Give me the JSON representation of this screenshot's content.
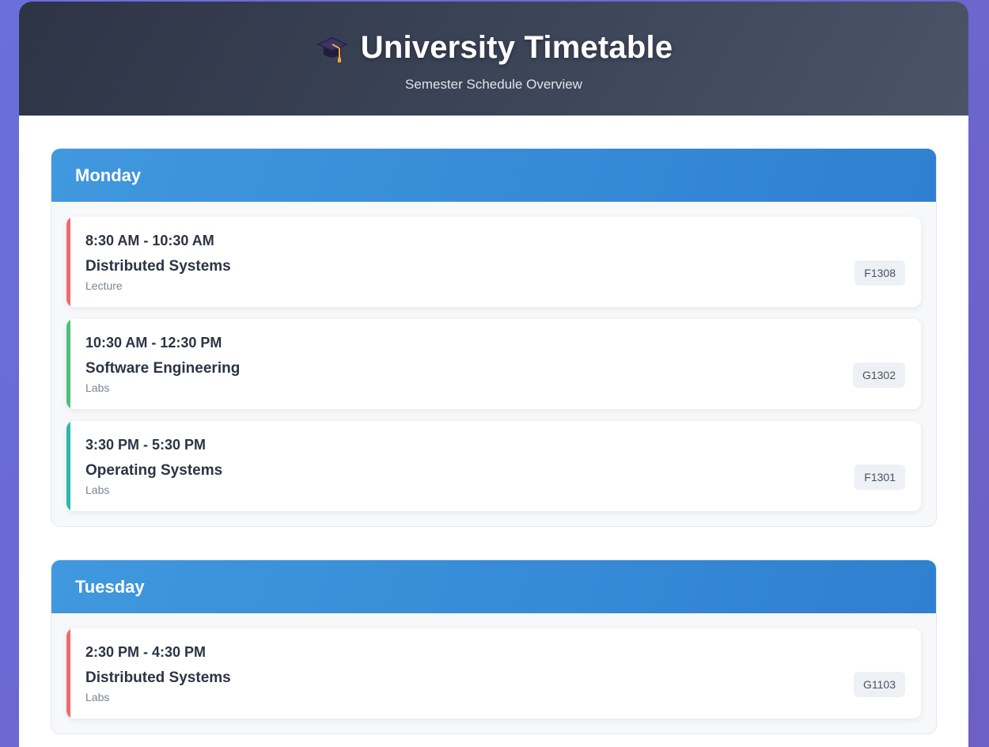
{
  "header": {
    "icon": "graduation-cap-icon",
    "title": "University Timetable",
    "subtitle": "Semester Schedule Overview"
  },
  "days": [
    {
      "name": "Monday",
      "slots": [
        {
          "time": "8:30 AM - 10:30 AM",
          "course": "Distributed Systems",
          "type": "Lecture",
          "room": "F1308",
          "accent": "#f06a6a"
        },
        {
          "time": "10:30 AM - 12:30 PM",
          "course": "Software Engineering",
          "type": "Labs",
          "room": "G1302",
          "accent": "#4cc07a"
        },
        {
          "time": "3:30 PM - 5:30 PM",
          "course": "Operating Systems",
          "type": "Labs",
          "room": "F1301",
          "accent": "#2bb8a8"
        }
      ]
    },
    {
      "name": "Tuesday",
      "slots": [
        {
          "time": "2:30 PM - 4:30 PM",
          "course": "Distributed Systems",
          "type": "Labs",
          "room": "G1103",
          "accent": "#f06a6a"
        }
      ]
    }
  ]
}
